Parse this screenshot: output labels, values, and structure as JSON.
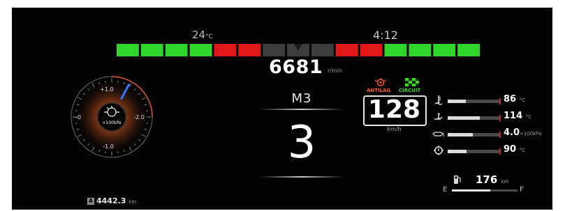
{
  "temp": {
    "value": "24",
    "unit": "°C"
  },
  "clock": "4:12",
  "rpm": {
    "value": "6681",
    "unit": "r/min"
  },
  "drive_mode": "M3",
  "gear": "3",
  "speed": {
    "value": "128",
    "unit": "km/h"
  },
  "indicators": {
    "antilag": "ANTILAG",
    "circuit": "CIRCUIT"
  },
  "boost": {
    "label_top": "+1.0",
    "label_left": "-0",
    "label_right": "-2.0",
    "label_bottom": "-1.0",
    "unit": "×100kPa",
    "needle_value": 0.55
  },
  "gauges": [
    {
      "icon": "coolant-temp-icon",
      "value": "86",
      "unit": "°C",
      "fill": 0.35
    },
    {
      "icon": "oil-temp-icon",
      "value": "114",
      "unit": "°C",
      "fill": 0.62
    },
    {
      "icon": "oil-pressure-icon",
      "value": "4.0",
      "unit": "×100kPa",
      "fill": 0.48
    },
    {
      "icon": "transmission-temp-icon",
      "value": "90",
      "unit": "°C",
      "fill": 0.36
    }
  ],
  "fuel": {
    "range": "176",
    "unit": "km",
    "e_label": "E",
    "f_label": "F",
    "level": 0.58
  },
  "odometer": {
    "badge": "A",
    "value": "4442.3",
    "unit": "km"
  },
  "colors": {
    "green": "#2fd52a",
    "red": "#e01818",
    "grey": "#3d3d3d",
    "accent_orange": "#ff6a1a",
    "needle": "#2a7dff"
  },
  "revbar": {
    "segments": [
      "green",
      "green",
      "green",
      "green",
      "red",
      "red",
      "grey",
      "grey",
      "grey",
      "red",
      "red",
      "green",
      "green",
      "green",
      "green"
    ]
  }
}
